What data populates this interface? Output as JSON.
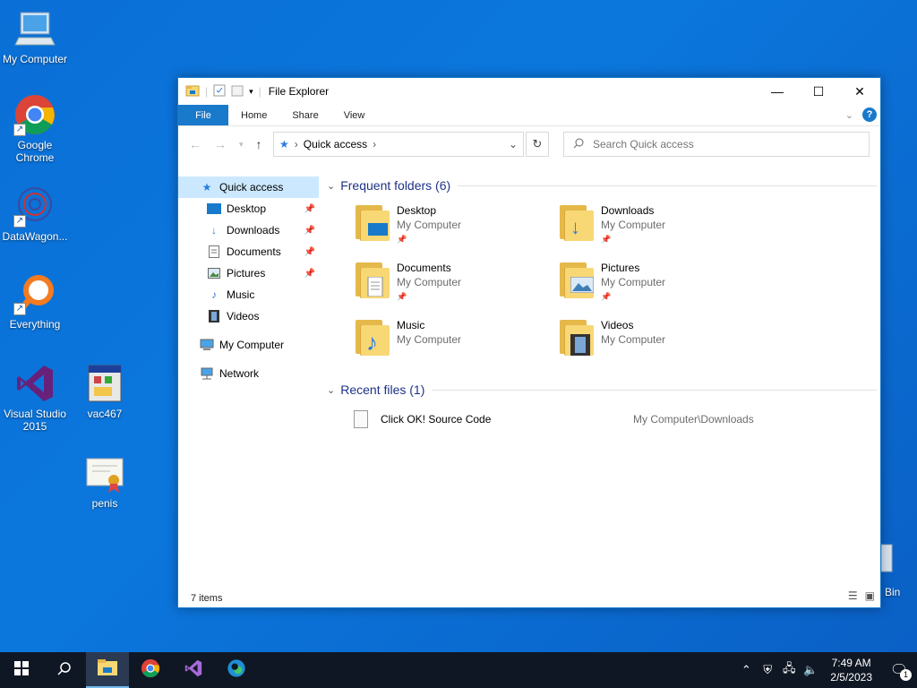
{
  "desktop": {
    "icons": [
      {
        "label": "My Computer",
        "icon": "computer-icon"
      },
      {
        "label": "Google Chrome",
        "icon": "chrome-icon"
      },
      {
        "label": "DataWagon...",
        "icon": "datawagon-icon"
      },
      {
        "label": "Everything",
        "icon": "everything-search-icon"
      },
      {
        "label": "Visual Studio 2015",
        "icon": "visual-studio-icon"
      },
      {
        "label": "vac467",
        "icon": "installer-icon"
      },
      {
        "label": "penis",
        "icon": "certificate-icon"
      }
    ],
    "recycle_bin_label": "Bin"
  },
  "window": {
    "title": "File Explorer",
    "controls": {
      "minimize": "—",
      "maximize": "☐",
      "close": "✕"
    },
    "ribbon_tabs": [
      "File",
      "Home",
      "Share",
      "View"
    ],
    "address": {
      "root_icon": "quick-access-star-icon",
      "path": "Quick access",
      "separator": "›"
    },
    "search_placeholder": "Search Quick access",
    "nav_pane": {
      "quick_access": "Quick access",
      "pinned": [
        "Desktop",
        "Downloads",
        "Documents",
        "Pictures"
      ],
      "unpinned": [
        "Music",
        "Videos"
      ],
      "my_computer": "My Computer",
      "network": "Network"
    },
    "frequent_header": "Frequent folders (6)",
    "frequent_folders": [
      {
        "name": "Desktop",
        "location": "My Computer",
        "pinned": true
      },
      {
        "name": "Downloads",
        "location": "My Computer",
        "pinned": true
      },
      {
        "name": "Documents",
        "location": "My Computer",
        "pinned": true
      },
      {
        "name": "Pictures",
        "location": "My Computer",
        "pinned": true
      },
      {
        "name": "Music",
        "location": "My Computer",
        "pinned": false
      },
      {
        "name": "Videos",
        "location": "My Computer",
        "pinned": false
      }
    ],
    "recent_header": "Recent files (1)",
    "recent_files": [
      {
        "name": "Click OK! Source Code",
        "location": "My Computer\\Downloads"
      }
    ],
    "status": "7 items"
  },
  "taskbar": {
    "clock_time": "7:49 AM",
    "clock_date": "2/5/2023",
    "notification_count": "1"
  },
  "colors": {
    "accent": "#1979ca",
    "desktop_bg": "#0a6fd6",
    "taskbar_bg": "#101724",
    "folder_yellow": "#f8d775"
  }
}
